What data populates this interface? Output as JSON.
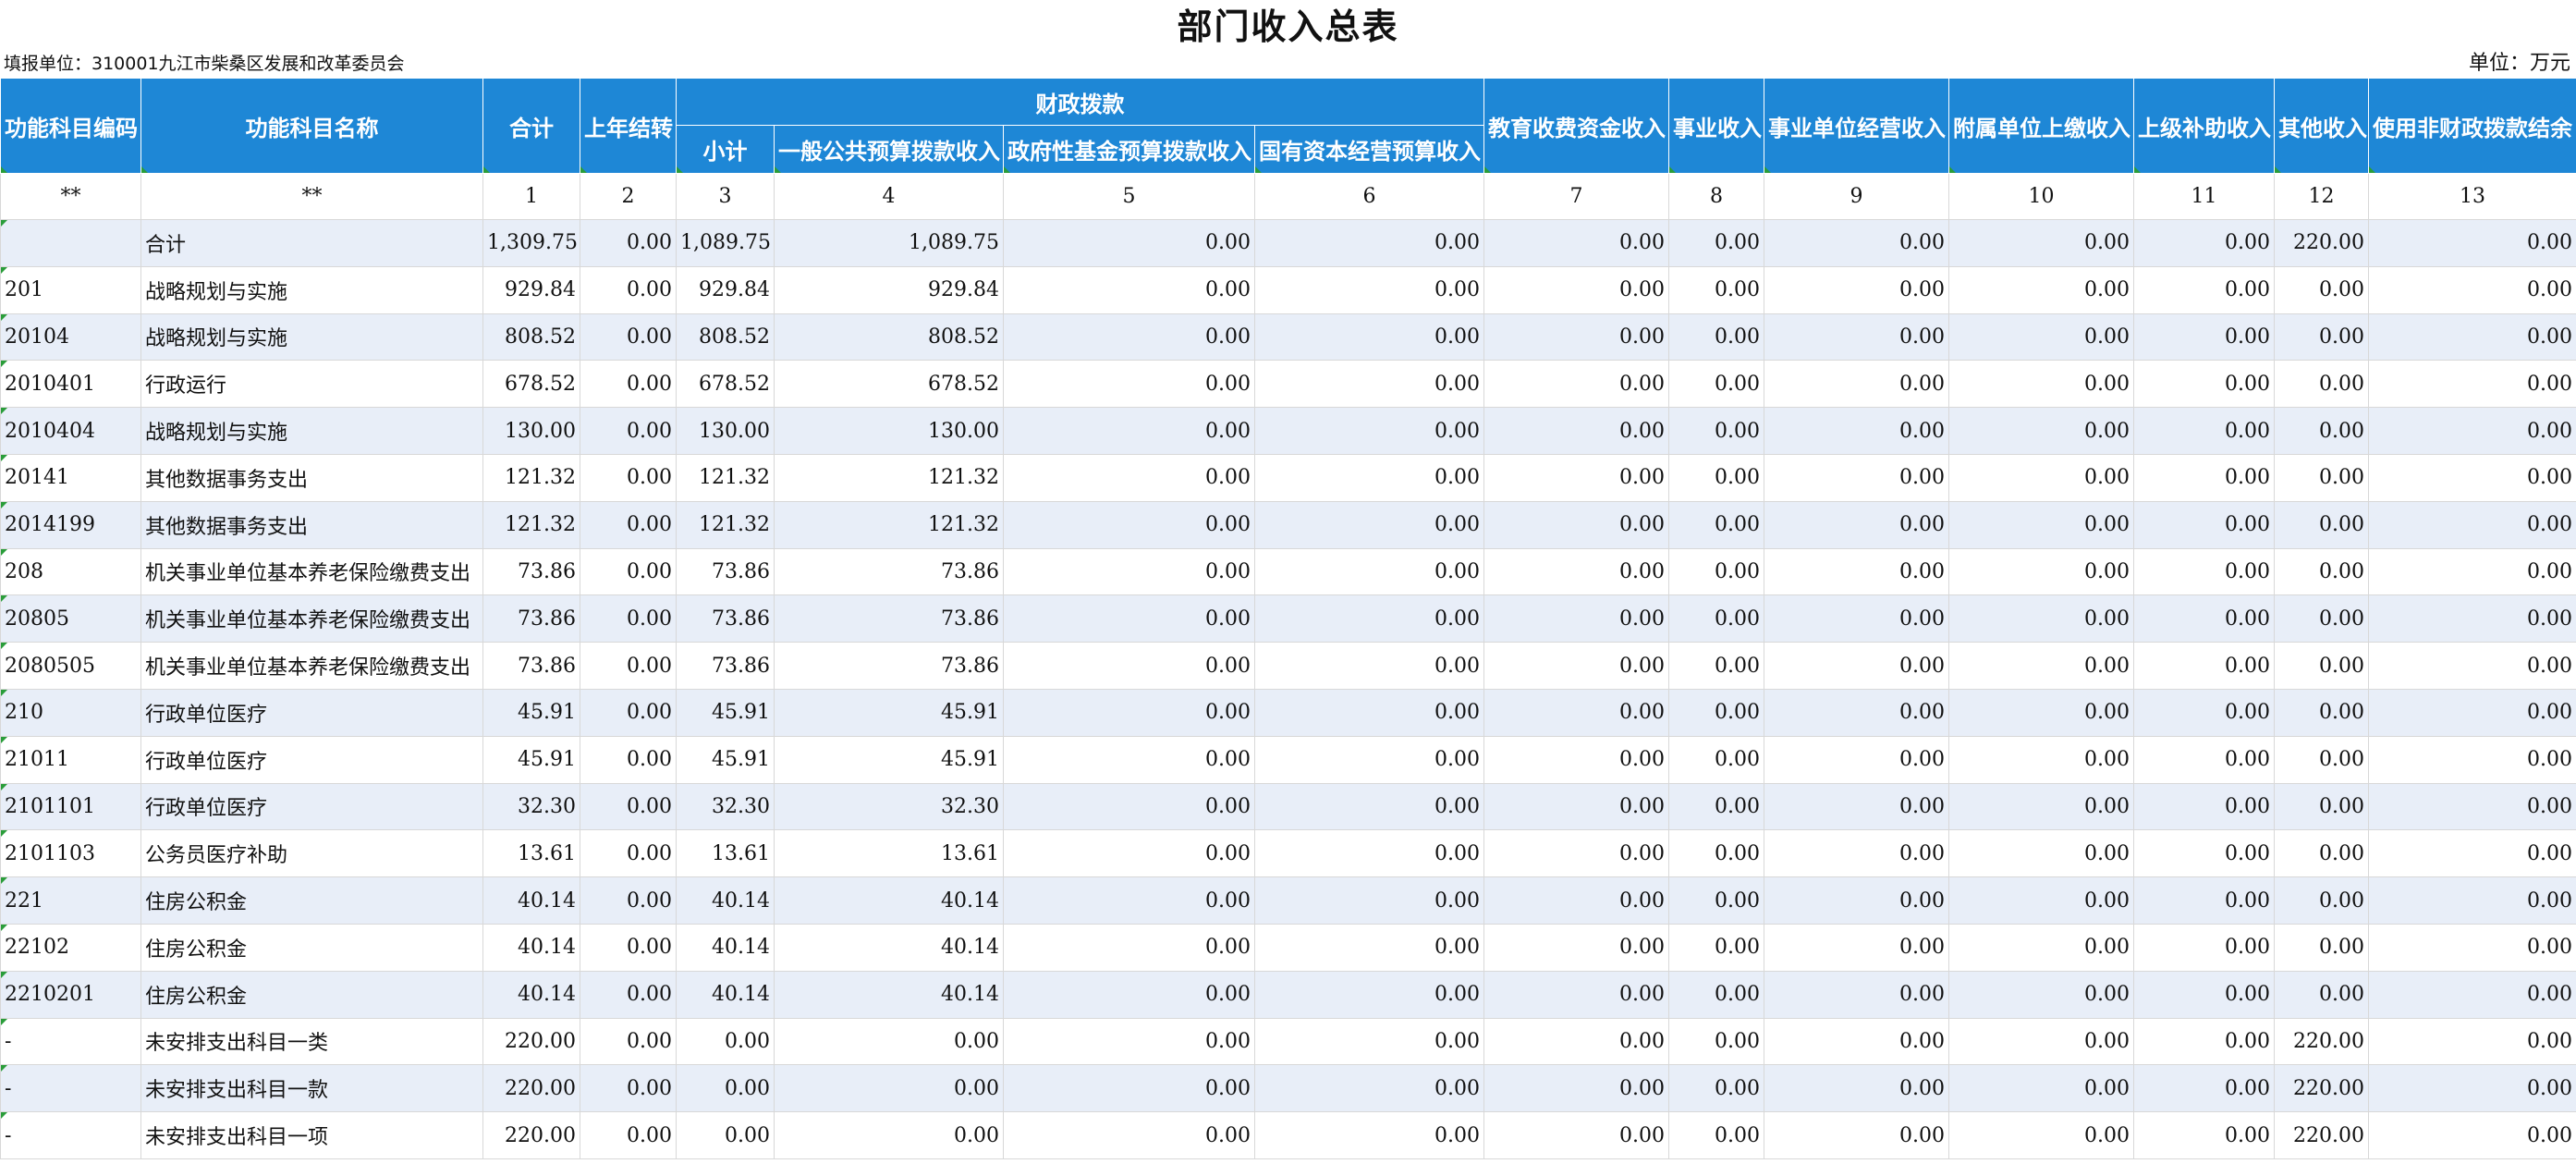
{
  "title": "部门收入总表",
  "filing_unit": "填报单位：310001九江市柴桑区发展和改革委员会",
  "unit": "单位：万元",
  "headers": {
    "code": "功能科目编码",
    "name": "功能科目名称",
    "total": "合计",
    "carryover": "上年结转",
    "fiscal": "财政拨款",
    "subtotal": "小计",
    "general_budget": "一般公共预算拨款收入",
    "gov_fund": "政府性基金预算拨款收入",
    "state_capital": "国有资本经营预算收入",
    "education": "教育收费资金收入",
    "business": "事业收入",
    "business_operation": "事业单位经营收入",
    "affiliated": "附属单位上缴收入",
    "superior": "上级补助收入",
    "other": "其他收入",
    "non_fiscal_balance": "使用非财政拨款结余"
  },
  "index_row": [
    "**",
    "**",
    "1",
    "2",
    "3",
    "4",
    "5",
    "6",
    "7",
    "8",
    "9",
    "10",
    "11",
    "12",
    "13"
  ],
  "rows": [
    {
      "code": "",
      "name": "合计",
      "v": [
        "1,309.75",
        "0.00",
        "1,089.75",
        "1,089.75",
        "0.00",
        "0.00",
        "0.00",
        "0.00",
        "0.00",
        "0.00",
        "0.00",
        "220.00",
        "0.00"
      ]
    },
    {
      "code": "201",
      "name": "战略规划与实施",
      "v": [
        "929.84",
        "0.00",
        "929.84",
        "929.84",
        "0.00",
        "0.00",
        "0.00",
        "0.00",
        "0.00",
        "0.00",
        "0.00",
        "0.00",
        "0.00"
      ]
    },
    {
      "code": "20104",
      "name": "战略规划与实施",
      "v": [
        "808.52",
        "0.00",
        "808.52",
        "808.52",
        "0.00",
        "0.00",
        "0.00",
        "0.00",
        "0.00",
        "0.00",
        "0.00",
        "0.00",
        "0.00"
      ]
    },
    {
      "code": "2010401",
      "name": "行政运行",
      "v": [
        "678.52",
        "0.00",
        "678.52",
        "678.52",
        "0.00",
        "0.00",
        "0.00",
        "0.00",
        "0.00",
        "0.00",
        "0.00",
        "0.00",
        "0.00"
      ]
    },
    {
      "code": "2010404",
      "name": "战略规划与实施",
      "v": [
        "130.00",
        "0.00",
        "130.00",
        "130.00",
        "0.00",
        "0.00",
        "0.00",
        "0.00",
        "0.00",
        "0.00",
        "0.00",
        "0.00",
        "0.00"
      ]
    },
    {
      "code": "20141",
      "name": "其他数据事务支出",
      "v": [
        "121.32",
        "0.00",
        "121.32",
        "121.32",
        "0.00",
        "0.00",
        "0.00",
        "0.00",
        "0.00",
        "0.00",
        "0.00",
        "0.00",
        "0.00"
      ]
    },
    {
      "code": "2014199",
      "name": "其他数据事务支出",
      "v": [
        "121.32",
        "0.00",
        "121.32",
        "121.32",
        "0.00",
        "0.00",
        "0.00",
        "0.00",
        "0.00",
        "0.00",
        "0.00",
        "0.00",
        "0.00"
      ]
    },
    {
      "code": "208",
      "name": "机关事业单位基本养老保险缴费支出",
      "v": [
        "73.86",
        "0.00",
        "73.86",
        "73.86",
        "0.00",
        "0.00",
        "0.00",
        "0.00",
        "0.00",
        "0.00",
        "0.00",
        "0.00",
        "0.00"
      ]
    },
    {
      "code": "20805",
      "name": "机关事业单位基本养老保险缴费支出",
      "v": [
        "73.86",
        "0.00",
        "73.86",
        "73.86",
        "0.00",
        "0.00",
        "0.00",
        "0.00",
        "0.00",
        "0.00",
        "0.00",
        "0.00",
        "0.00"
      ]
    },
    {
      "code": "2080505",
      "name": "机关事业单位基本养老保险缴费支出",
      "v": [
        "73.86",
        "0.00",
        "73.86",
        "73.86",
        "0.00",
        "0.00",
        "0.00",
        "0.00",
        "0.00",
        "0.00",
        "0.00",
        "0.00",
        "0.00"
      ]
    },
    {
      "code": "210",
      "name": "行政单位医疗",
      "v": [
        "45.91",
        "0.00",
        "45.91",
        "45.91",
        "0.00",
        "0.00",
        "0.00",
        "0.00",
        "0.00",
        "0.00",
        "0.00",
        "0.00",
        "0.00"
      ]
    },
    {
      "code": "21011",
      "name": "行政单位医疗",
      "v": [
        "45.91",
        "0.00",
        "45.91",
        "45.91",
        "0.00",
        "0.00",
        "0.00",
        "0.00",
        "0.00",
        "0.00",
        "0.00",
        "0.00",
        "0.00"
      ]
    },
    {
      "code": "2101101",
      "name": "行政单位医疗",
      "v": [
        "32.30",
        "0.00",
        "32.30",
        "32.30",
        "0.00",
        "0.00",
        "0.00",
        "0.00",
        "0.00",
        "0.00",
        "0.00",
        "0.00",
        "0.00"
      ]
    },
    {
      "code": "2101103",
      "name": "公务员医疗补助",
      "v": [
        "13.61",
        "0.00",
        "13.61",
        "13.61",
        "0.00",
        "0.00",
        "0.00",
        "0.00",
        "0.00",
        "0.00",
        "0.00",
        "0.00",
        "0.00"
      ]
    },
    {
      "code": "221",
      "name": "住房公积金",
      "v": [
        "40.14",
        "0.00",
        "40.14",
        "40.14",
        "0.00",
        "0.00",
        "0.00",
        "0.00",
        "0.00",
        "0.00",
        "0.00",
        "0.00",
        "0.00"
      ]
    },
    {
      "code": "22102",
      "name": "住房公积金",
      "v": [
        "40.14",
        "0.00",
        "40.14",
        "40.14",
        "0.00",
        "0.00",
        "0.00",
        "0.00",
        "0.00",
        "0.00",
        "0.00",
        "0.00",
        "0.00"
      ]
    },
    {
      "code": "2210201",
      "name": "住房公积金",
      "v": [
        "40.14",
        "0.00",
        "40.14",
        "40.14",
        "0.00",
        "0.00",
        "0.00",
        "0.00",
        "0.00",
        "0.00",
        "0.00",
        "0.00",
        "0.00"
      ]
    },
    {
      "code": "-",
      "name": "未安排支出科目一类",
      "v": [
        "220.00",
        "0.00",
        "0.00",
        "0.00",
        "0.00",
        "0.00",
        "0.00",
        "0.00",
        "0.00",
        "0.00",
        "0.00",
        "220.00",
        "0.00"
      ]
    },
    {
      "code": "-",
      "name": "未安排支出科目一款",
      "v": [
        "220.00",
        "0.00",
        "0.00",
        "0.00",
        "0.00",
        "0.00",
        "0.00",
        "0.00",
        "0.00",
        "0.00",
        "0.00",
        "220.00",
        "0.00"
      ]
    },
    {
      "code": "-",
      "name": "未安排支出科目一项",
      "v": [
        "220.00",
        "0.00",
        "0.00",
        "0.00",
        "0.00",
        "0.00",
        "0.00",
        "0.00",
        "0.00",
        "0.00",
        "0.00",
        "220.00",
        "0.00"
      ]
    }
  ]
}
